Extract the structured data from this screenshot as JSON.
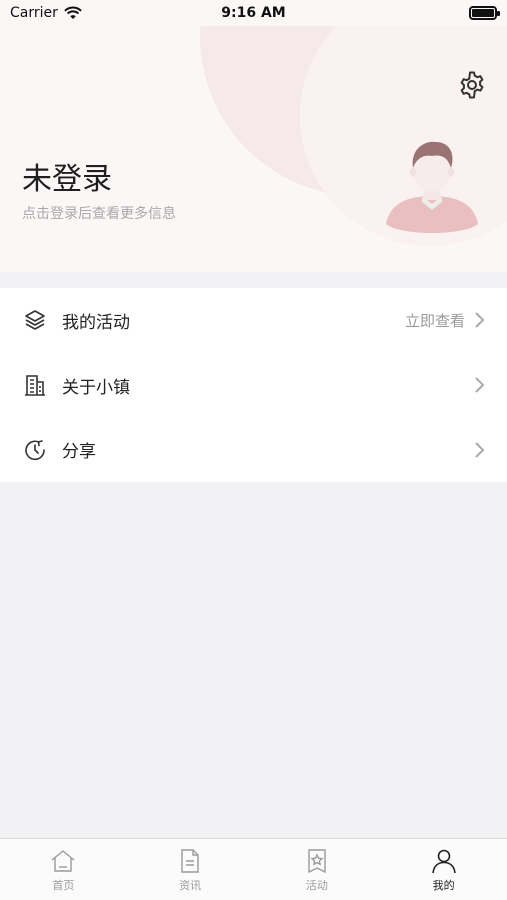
{
  "status_bar": {
    "carrier": "Carrier",
    "time": "9:16 AM"
  },
  "profile": {
    "name": "未登录",
    "hint": "点击登录后查看更多信息"
  },
  "menu": {
    "items": [
      {
        "label": "我的活动",
        "extra": "立即查看",
        "icon": "layers-icon"
      },
      {
        "label": "关于小镇",
        "extra": "",
        "icon": "building-icon"
      },
      {
        "label": "分享",
        "extra": "",
        "icon": "share-refresh-icon"
      }
    ]
  },
  "tabbar": {
    "tabs": [
      {
        "label": "首页",
        "icon": "home-icon",
        "active": false
      },
      {
        "label": "资讯",
        "icon": "document-icon",
        "active": false
      },
      {
        "label": "活动",
        "icon": "bookmark-star-icon",
        "active": false
      },
      {
        "label": "我的",
        "icon": "person-icon",
        "active": true
      }
    ]
  },
  "colors": {
    "header_bg": "#fbf7f7",
    "page_bg": "#f2f2f4",
    "avatar_shirt": "#eabfbf",
    "avatar_hair": "#9a7472"
  }
}
